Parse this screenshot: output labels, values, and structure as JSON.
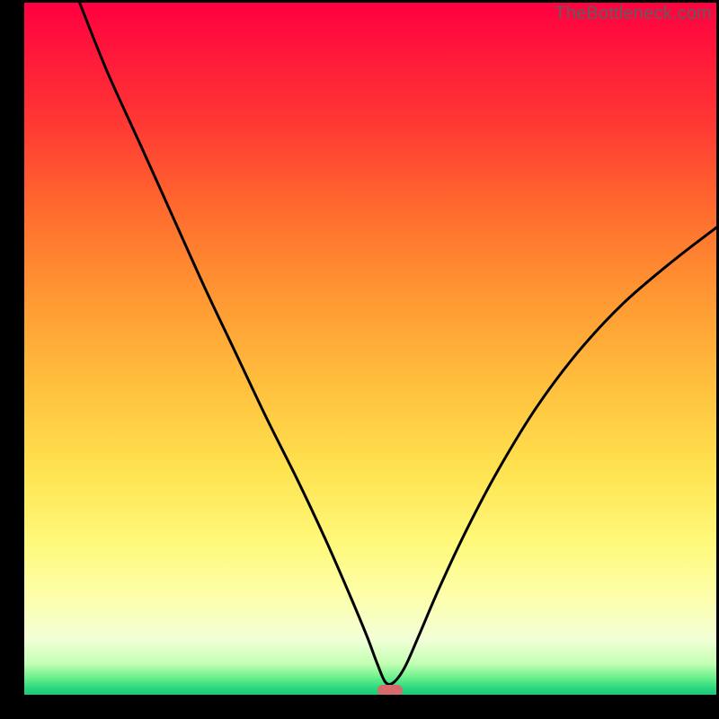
{
  "watermark": "TheBottleneck.com",
  "chart_data": {
    "type": "line",
    "title": "",
    "xlabel": "",
    "ylabel": "",
    "xlim": [
      0,
      100
    ],
    "ylim": [
      0,
      100
    ],
    "grid": false,
    "legend": false,
    "gradient_stops": [
      {
        "pct": 0,
        "color": "#ff0040"
      },
      {
        "pct": 8,
        "color": "#ff1a3a"
      },
      {
        "pct": 18,
        "color": "#ff3a33"
      },
      {
        "pct": 30,
        "color": "#ff6b2e"
      },
      {
        "pct": 42,
        "color": "#ff9632"
      },
      {
        "pct": 55,
        "color": "#ffbf3d"
      },
      {
        "pct": 67,
        "color": "#ffe14e"
      },
      {
        "pct": 78,
        "color": "#fff97a"
      },
      {
        "pct": 86,
        "color": "#fdffac"
      },
      {
        "pct": 92,
        "color": "#f2ffd7"
      },
      {
        "pct": 95.5,
        "color": "#c4ffb4"
      },
      {
        "pct": 97.5,
        "color": "#6cf08c"
      },
      {
        "pct": 99,
        "color": "#2cd87f"
      },
      {
        "pct": 100,
        "color": "#19c979"
      }
    ],
    "series": [
      {
        "name": "bottleneck-curve",
        "x": [
          8.0,
          12.0,
          17.0,
          21.5,
          26.0,
          30.5,
          35.0,
          39.5,
          43.5,
          47.0,
          49.5,
          51.0,
          52.2,
          53.4,
          55.0,
          57.0,
          60.0,
          64.0,
          68.5,
          74.0,
          80.0,
          86.5,
          93.5,
          100.0
        ],
        "y": [
          100.0,
          90.0,
          79.0,
          69.0,
          59.0,
          49.5,
          40.0,
          31.0,
          22.5,
          14.5,
          8.5,
          4.5,
          1.8,
          1.8,
          4.0,
          8.5,
          15.5,
          24.0,
          32.5,
          41.5,
          49.5,
          56.5,
          62.5,
          67.5
        ]
      }
    ],
    "marker": {
      "x": 52.8,
      "y": 0.7,
      "color": "#d76a6a"
    }
  }
}
